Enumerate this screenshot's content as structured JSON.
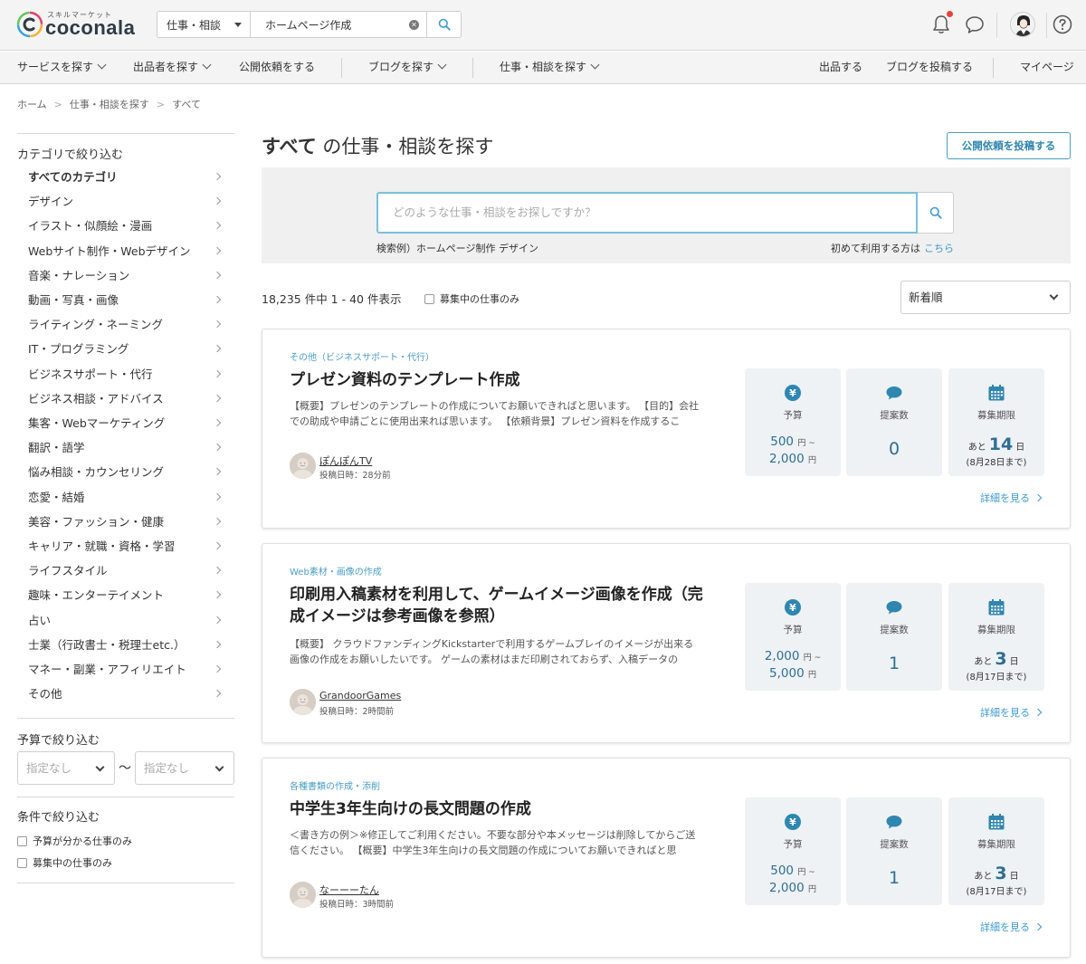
{
  "header": {
    "logo_small": "スキルマーケット",
    "logo_text": "coconala",
    "search_category": "仕事・相談",
    "search_query": "ホームページ作成"
  },
  "nav": {
    "left": [
      {
        "label": "サービスを探す",
        "chevron": true
      },
      {
        "label": "出品者を探す",
        "chevron": true
      },
      {
        "label": "公開依頼をする",
        "chevron": false
      },
      {
        "label": "ブログを探す",
        "chevron": true
      },
      {
        "label": "仕事・相談を探す",
        "chevron": true
      }
    ],
    "right": [
      "出品する",
      "ブログを投稿する",
      "マイページ"
    ]
  },
  "breadcrumb": [
    "ホーム",
    "仕事・相談を探す",
    "すべて"
  ],
  "sidebar": {
    "category_title": "カテゴリで絞り込む",
    "categories": [
      "すべてのカテゴリ",
      "デザイン",
      "イラスト・似顔絵・漫画",
      "Webサイト制作・Webデザイン",
      "音楽・ナレーション",
      "動画・写真・画像",
      "ライティング・ネーミング",
      "IT・プログラミング",
      "ビジネスサポート・代行",
      "ビジネス相談・アドバイス",
      "集客・Webマーケティング",
      "翻訳・語学",
      "悩み相談・カウンセリング",
      "恋愛・結婚",
      "美容・ファッション・健康",
      "キャリア・就職・資格・学習",
      "ライフスタイル",
      "趣味・エンターテイメント",
      "占い",
      "士業（行政書士・税理士etc.）",
      "マネー・副業・アフィリエイト",
      "その他"
    ],
    "budget_title": "予算で絞り込む",
    "budget_min": "指定なし",
    "budget_tilde": "〜",
    "budget_max": "指定なし",
    "condition_title": "条件で絞り込む",
    "conditions": [
      "予算が分かる仕事のみ",
      "募集中の仕事のみ"
    ]
  },
  "main": {
    "title_bold": "すべて",
    "title_rest": "の仕事・相談を探す",
    "post_button": "公開依頼を投稿する",
    "search_placeholder": "どのような仕事・相談をお探しですか？",
    "examples": "検索例）ホームページ制作 デザイン",
    "first_time": "初めて利用する方は",
    "first_time_link": "こちら",
    "count": "18,235 件中 1 - 40 件表示",
    "recruiting_only": "募集中の仕事のみ",
    "sort": "新着順"
  },
  "stat_labels": {
    "budget": "予算",
    "proposals": "提案数",
    "deadline": "募集期限",
    "yen": "円",
    "remain_prefix": "あと",
    "remain_suffix": "日",
    "detail": "詳細を見る"
  },
  "jobs": [
    {
      "category": "その他（ビジネスサポート・代行）",
      "title": "プレゼン資料のテンプレート作成",
      "description": "【概要】プレゼンのテンプレートの作成についてお願いできればと思います。 【目的】会社での助成や申請ごとに使用出来れば思います。 【依頼背景】プレゼン資料を作成するこ",
      "user": "ぽんぽんTV",
      "posted": "投稿日時：28分前",
      "budget_min": "500",
      "budget_max": "2,000",
      "proposals": "0",
      "days": "14",
      "deadline_date": "(8月28日まで)"
    },
    {
      "category": "Web素材・画像の作成",
      "title": "印刷用入稿素材を利用して、ゲームイメージ画像を作成（完成イメージは参考画像を参照）",
      "description": "【概要】 クラウドファンディングKickstarterで利用するゲームプレイのイメージが出来る画像の作成をお願いしたいです。 ゲームの素材はまだ印刷されておらず、入稿データの",
      "user": "GrandoorGames",
      "posted": "投稿日時：2時間前",
      "budget_min": "2,000",
      "budget_max": "5,000",
      "proposals": "1",
      "days": "3",
      "deadline_date": "(8月17日まで)"
    },
    {
      "category": "各種書類の作成・添削",
      "title": "中学生3年生向けの長文問題の作成",
      "description": "＜書き方の例＞※修正してご利用ください。不要な部分や本メッセージは削除してからご送信ください。 【概要】中学生3年生向けの長文問題の作成についてお願いできればと思",
      "user": "なーーーたん",
      "posted": "投稿日時：3時間前",
      "budget_min": "500",
      "budget_max": "2,000",
      "proposals": "1",
      "days": "3",
      "deadline_date": "(8月17日まで)"
    }
  ]
}
